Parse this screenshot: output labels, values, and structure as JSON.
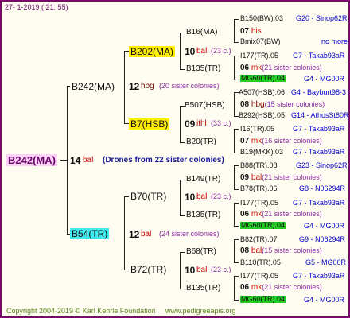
{
  "header": {
    "date": "27-  1-2019 ( 21: 55)"
  },
  "root": {
    "id": "B242(MA)",
    "gen_num": "14",
    "gen_label": "bal",
    "drones_note": "(Drones from 22 sister colonies)"
  },
  "gen1": {
    "queen": {
      "id": "B242(MA)",
      "num": "12",
      "label": "hbg",
      "note": "(20 sister colonies)"
    },
    "drone": {
      "id": "B54(TR)",
      "num": "12",
      "label": "bal",
      "note": "(24 sister colonies)"
    }
  },
  "gen2": {
    "qq": {
      "id": "B202(MA)",
      "num": "10",
      "label": "bal",
      "note": "(23 c.)"
    },
    "qd": {
      "id": "B7(HSB)",
      "num": "09",
      "label": "ithl",
      "note": "(33 c.)"
    },
    "dq": {
      "id": "B70(TR)",
      "num": "10",
      "label": "bal",
      "note": "(23 c.)"
    },
    "dd": {
      "id": "B72(TR)",
      "num": "10",
      "label": "bal",
      "note": "(23 c.)"
    }
  },
  "gen3": [
    {
      "id": "B16(MA)",
      "num": "07",
      "label": "his"
    },
    {
      "id": "B135(TR)",
      "num": "06",
      "label": "mk",
      "note": "(21 sister colonies)"
    },
    {
      "id": "B507(HSB)",
      "num": "08",
      "label": "hbg",
      "note": "(15 sister colonies)"
    },
    {
      "id": "B20(TR)",
      "num": "07",
      "label": "mk",
      "note": "(16 sister colonies)"
    },
    {
      "id": "B149(TR)",
      "num": "09",
      "label": "bal",
      "note": "(21 sister colonies)"
    },
    {
      "id": "B135(TR)",
      "num": "06",
      "label": "mk",
      "note": "(21 sister colonies)"
    },
    {
      "id": "B68(TR)",
      "num": "08",
      "label": "bal",
      "note": "(15 sister colonies)"
    },
    {
      "id": "B135(TR)",
      "num": "06",
      "label": "mk",
      "note": "(21 sister colonies)"
    }
  ],
  "gen4": [
    {
      "left": "B150(BW).03",
      "right": "G20 - Sinop62R"
    },
    {
      "left": "Bmix07(BW)",
      "right": "no more"
    },
    {
      "left": "I177(TR).05",
      "right": "G7 - Takab93aR"
    },
    {
      "left": "MG60(TR).04",
      "right": "G4 - MG00R"
    },
    {
      "left": "A507(HSB).06",
      "right": "G4 - Bayburt98-3"
    },
    {
      "left": "B292(HSB).05",
      "right": "G14 - AthosSt80R"
    },
    {
      "left": "I16(TR).05",
      "right": "G7 - Takab93aR"
    },
    {
      "left": "B19(MKK).03",
      "right": "G7 - Takab93aR"
    },
    {
      "left": "B88(TR).08",
      "right": "G23 - Sinop62R"
    },
    {
      "left": "B78(TR).06",
      "right": "G8 - N06294R"
    },
    {
      "left": "I177(TR).05",
      "right": "G7 - Takab93aR"
    },
    {
      "left": "MG60(TR).04",
      "right": "G4 - MG00R"
    },
    {
      "left": "B82(TR).07",
      "right": "G9 - N06294R"
    },
    {
      "left": "B110(TR).05",
      "right": "G5 - MG00R"
    },
    {
      "left": "I177(TR).05",
      "right": "G7 - Takab93aR"
    },
    {
      "left": "MG60(TR).04",
      "right": "G4 - MG00R"
    }
  ],
  "footer": {
    "copyright": "Copyright 2004-2019 © Karl Kehrle Foundation",
    "url": "www.pedigreeapis.org"
  }
}
